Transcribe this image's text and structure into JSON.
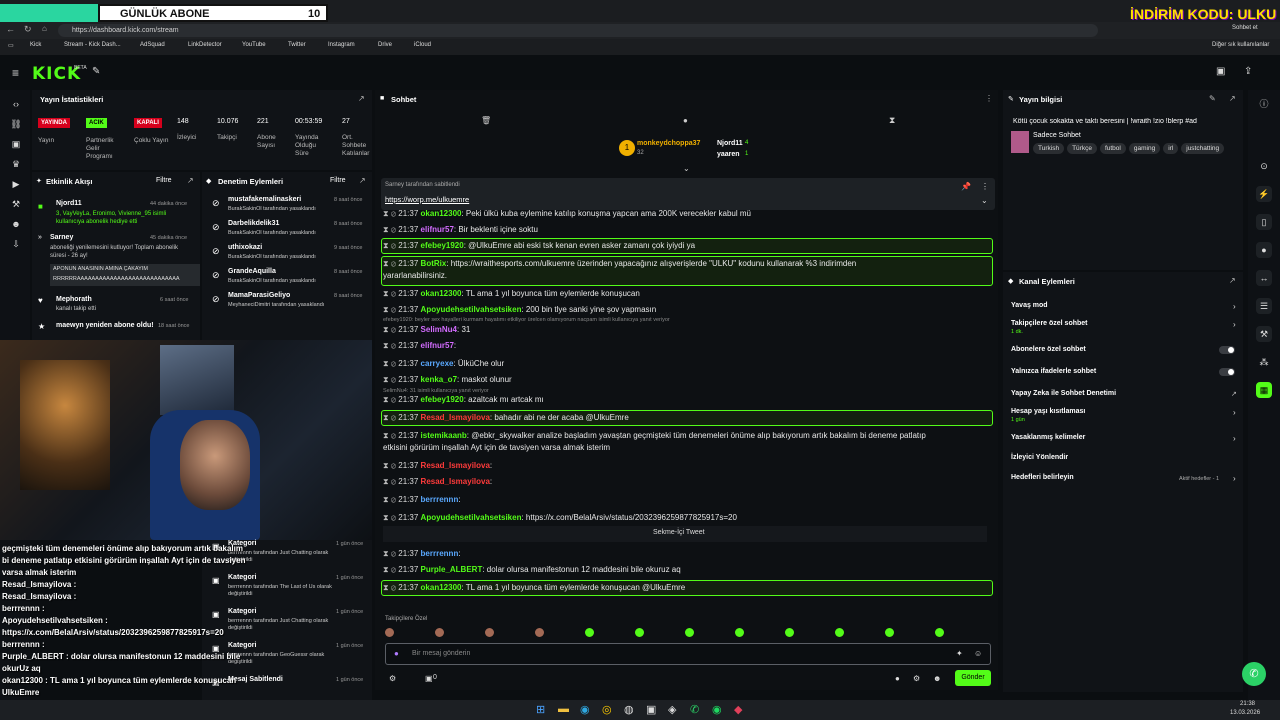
{
  "overlay": {
    "banner_title": "GÜNLÜK ABONE",
    "banner_count": "10",
    "promo": "İNDİRİM KODU: ULKU"
  },
  "browser": {
    "tab_label": "Sohbet et",
    "url": "https://dashboard.kick.com/stream",
    "bookmarks": [
      "Kick",
      "Stream - Kick Dash...",
      "AdSquad",
      "LinkDetector",
      "YouTube",
      "Twitter",
      "Instagram",
      "Drive",
      "iCloud"
    ],
    "other_bookmarks": "Diğer sık kullanılanlar"
  },
  "header": {
    "logo": "KICK",
    "logo_badge": "BETA"
  },
  "stats": {
    "title": "Yayın İstatistikleri",
    "badges": [
      "YAYINDA",
      "ACIK",
      "KAPALI"
    ],
    "items": [
      {
        "label": "Yayın",
        "value": ""
      },
      {
        "label": "Partnerlik Gelir Programı",
        "value": ""
      },
      {
        "label": "Çoklu Yayın",
        "value": ""
      },
      {
        "label": "İzleyici",
        "value": "148"
      },
      {
        "label": "Takipçi",
        "value": "10.076"
      },
      {
        "label": "Abone Sayısı",
        "value": "221"
      },
      {
        "label": "Yayında Olduğu Süre",
        "value": "00:53:59"
      },
      {
        "label": "Ort. Sohbete Katılanlar",
        "value": "27"
      }
    ]
  },
  "activity": {
    "title": "Etkinlik Akışı",
    "filter": "Filtre",
    "items": [
      {
        "user": "Njord11",
        "time": "44 dakika önce",
        "text": "3, VayVeyLa, Eronimo, Vivienne_95 isimli kullanıcıya abonelik hediye etti"
      },
      {
        "user": "Sarney",
        "time": "45 dakika önce",
        "text": "aboneliği yenilemesini kutluyor! Toplam abonelik süresi - 26 ay!"
      },
      {
        "user": "Mephorath",
        "time": "6 saat önce",
        "text": "kanalı takip etti"
      },
      {
        "user": "maewyn yeniden abone oldu!",
        "time": "18 saat önce",
        "text": ""
      }
    ],
    "quote1": "APONUN ANASININ AMINA ÇAKAYIM",
    "quote2": "RRRRRRAAAAAAAAAAAAAAAAAAAAAAAAAAAA"
  },
  "moderation": {
    "title": "Denetim Eylemleri",
    "filter": "Filtre",
    "items": [
      {
        "user": "mustafakemalinaskeri",
        "time": "8 saat önce",
        "by": "BurakSakinOl tarafından yasaklandı"
      },
      {
        "user": "Darbelikdelik31",
        "time": "8 saat önce",
        "by": "BurakSakinOl tarafından yasaklandı"
      },
      {
        "user": "uthixokazi",
        "time": "9 saat önce",
        "by": "BurakSakinOl tarafından yasaklandı"
      },
      {
        "user": "GrandeAquilla",
        "time": "8 saat önce",
        "by": "BurakSakinOl tarafından yasaklandı"
      },
      {
        "user": "MamaParasiGeliyo",
        "time": "8 saat önce",
        "by": "MeyhaneciDimitri tarafından yasaklandı"
      }
    ],
    "lower": [
      {
        "title": "Kategori",
        "time": "1 gün önce",
        "text": "berrrennn tarafından Just Chatting olarak değiştirildi"
      },
      {
        "title": "Kategori",
        "time": "1 gün önce",
        "text": "berrrennn tarafından The Last of Us olarak değiştirildi"
      },
      {
        "title": "Kategori",
        "time": "1 gün önce",
        "text": "berrrennn tarafından Just Chatting olarak değiştirildi"
      },
      {
        "title": "Kategori",
        "time": "1 gün önce",
        "text": "berrrennn tarafından GeoGuessr olarak değiştirildi"
      },
      {
        "title": "Mesaj Sabitlendi",
        "time": "1 gün önce",
        "text": ""
      }
    ]
  },
  "overlay_chat": [
    {
      "text": "geçmişteki tüm denemeleri önüme alıp bakıyorum artık bakalım"
    },
    {
      "text": "bi deneme patlatıp etkisini görürüm inşallah Ayt için de tavsiyen"
    },
    {
      "text": "varsa almak isterim"
    },
    {
      "text": "Resad_Ismayilova :"
    },
    {
      "text": "Resad_Ismayilova :"
    },
    {
      "text": "berrrennn :"
    },
    {
      "text": "Apoyudehsetilvahsetsiken :"
    },
    {
      "text": "https://x.com/BelalArsiv/status/2032396259877825917s=20"
    },
    {
      "text": "berrrennn :"
    },
    {
      "text": "Purple_ALBERT : dolar olursa manifestonun 12 maddesini bile"
    },
    {
      "text": "okurUz aq"
    },
    {
      "text": "okan12300 : TL ama 1 yıl boyunca tüm eylemlerde konuşucan"
    },
    {
      "text": "UlkuEmre"
    }
  ],
  "chat": {
    "title": "Sohbet",
    "top_users": [
      {
        "name": "monkeydchoppa37",
        "score": "32"
      },
      {
        "name": "Njord11",
        "score": "4"
      },
      {
        "name": "yaaren",
        "score": "1"
      }
    ],
    "pinned": {
      "by": "Sarney tarafından sabitlendi",
      "link": "https://worp.me/ulkuemre"
    },
    "messages": [
      {
        "time": "21:37",
        "user": "okan12300",
        "text": "Peki ülkü kuba eylemine katılıp konuşma yapcan ama 200K verecekler kabul mü",
        "color": "#53fc18",
        "hl": false
      },
      {
        "time": "21:37",
        "user": "elifnur57",
        "text": "Bir beklenti içine soktu",
        "color": "#d36cff",
        "hl": false
      },
      {
        "time": "21:37",
        "user": "efebey1920",
        "text": "@UlkuEmre abi eski tsk kenan evren asker zamanı çok iyiydi ya",
        "color": "#53fc18",
        "hl": true
      },
      {
        "time": "21:37",
        "user": "BotRix",
        "text": "https://wraithesports.com/ulkuemre üzerinden yapacağınız alışverişlerde \"ULKU\" kodunu kullanarak %3 indirimden",
        "text2": "yararlanabilirsiniz.",
        "color": "#53fc18",
        "hl": true
      },
      {
        "time": "21:37",
        "user": "okan12300",
        "text": "TL ama 1 yıl boyunca tüm eylemlerde konuşucan",
        "color": "#53fc18",
        "hl": false
      },
      {
        "time": "21:37",
        "user": "Apoyudehsetilvahsetsiken",
        "text": "200 bin tlye sanki yine şov yapmasın",
        "color": "#53fc18",
        "hl": false
      },
      {
        "time": "21:37",
        "user": "SelimNu4",
        "text": "31",
        "color": "#d36cff",
        "hl": false
      },
      {
        "time": "21:37",
        "user": "elifnur57",
        "text": "",
        "color": "#d36cff",
        "hl": false
      },
      {
        "time": "21:37",
        "user": "carryexe",
        "text": "ÜlküChe olur",
        "color": "#5aa9ff",
        "hl": false
      },
      {
        "time": "21:37",
        "user": "kenka_o7",
        "text": "maskot olunur",
        "color": "#53fc18",
        "hl": false
      },
      {
        "time": "21:37",
        "user": "efebey1920",
        "text": "azaltcak mı artcak mı",
        "color": "#53fc18",
        "hl": false
      },
      {
        "time": "21:37",
        "user": "Resad_Ismayilova",
        "text": "bahadır abi ne der acaba @UlkuEmre",
        "color": "#ff3b3b",
        "hl": true
      },
      {
        "time": "21:37",
        "user": "istemikaanb",
        "text": "@ebkr_skywalker analize başladım yavaştan geçmişteki tüm denemeleri önüme alıp bakıyorum artık bakalım bi deneme patlatıp",
        "text2": "etkisini görürüm inşallah Ayt için de tavsiyen varsa almak isterim",
        "color": "#53fc18",
        "hl": false
      },
      {
        "time": "21:37",
        "user": "Resad_Ismayilova",
        "text": "",
        "color": "#ff3b3b",
        "hl": false
      },
      {
        "time": "21:37",
        "user": "Resad_Ismayilova",
        "text": "",
        "color": "#ff3b3b",
        "hl": false
      },
      {
        "time": "21:37",
        "user": "berrrennn",
        "text": "",
        "color": "#5aa9ff",
        "hl": false
      },
      {
        "time": "21:37",
        "user": "Apoyudehsetilvahsetsiken",
        "text": "https://x.com/BelalArsiv/status/2032396259877825917s=20",
        "color": "#53fc18",
        "hl": false
      },
      {
        "time": "21:37",
        "user": "berrrennn",
        "text": "",
        "color": "#5aa9ff",
        "hl": false
      },
      {
        "time": "21:37",
        "user": "Purple_ALBERT",
        "text": "dolar olursa manifestonun 12 maddesini bile okuruz aq",
        "color": "#53fc18",
        "hl": false
      },
      {
        "time": "21:37",
        "user": "okan12300",
        "text": "TL ama 1 yıl boyunca tüm eylemlerde konuşucan @UlkuEmre",
        "color": "#53fc18",
        "hl": true
      }
    ],
    "reply1": "efebey1920: beyler sex hayalleri kurmam hayatımı etkiliyor ürelcen olamıyorum nacpam isimli kullanıcıya yanıt veriyor",
    "reply2": "SelimNu4: 31 isimli kullanıcıya yanıt veriyor",
    "tweet_label": "Sekme-İçi Tweet",
    "followers_only": "Takipçilere Özel",
    "input_placeholder": "Bir mesaj gönderin",
    "send": "Gönder",
    "count": "0"
  },
  "stream_info": {
    "title": "Yayın bilgisi",
    "stream_title": "Kötü çocuk sokakta ve taktı beresini | !wraith !zio !blerp #ad",
    "category": "Sadece Sohbet",
    "tags": [
      "Turkish",
      "Türkçe",
      "futbol",
      "gaming",
      "irl",
      "justchatting"
    ]
  },
  "channel_actions": {
    "title": "Kanal Eylemleri",
    "items": [
      {
        "label": "Yavaş mod",
        "sub": ""
      },
      {
        "label": "Takipçilere özel sohbet",
        "sub": "1 dk."
      },
      {
        "label": "Abonelere özel sohbet",
        "sub": ""
      },
      {
        "label": "Yalnızca ifadelerle sohbet",
        "sub": ""
      },
      {
        "label": "Yapay Zeka ile Sohbet Denetimi",
        "sub": ""
      },
      {
        "label": "Hesap yaşı kısıtlaması",
        "sub": "1 gün"
      },
      {
        "label": "Yasaklanmış kelimeler",
        "sub": ""
      },
      {
        "label": "İzleyici Yönlendir",
        "sub": ""
      },
      {
        "label": "Hedefleri belirleyin",
        "sub": ""
      }
    ],
    "goals_status": "Aktif hedefler - 1"
  },
  "taskbar": {
    "time": "21:38",
    "date": "13.03.2026"
  },
  "colors": {
    "accent": "#53fc18",
    "panel": "#101317",
    "bg": "#0b0e11"
  }
}
